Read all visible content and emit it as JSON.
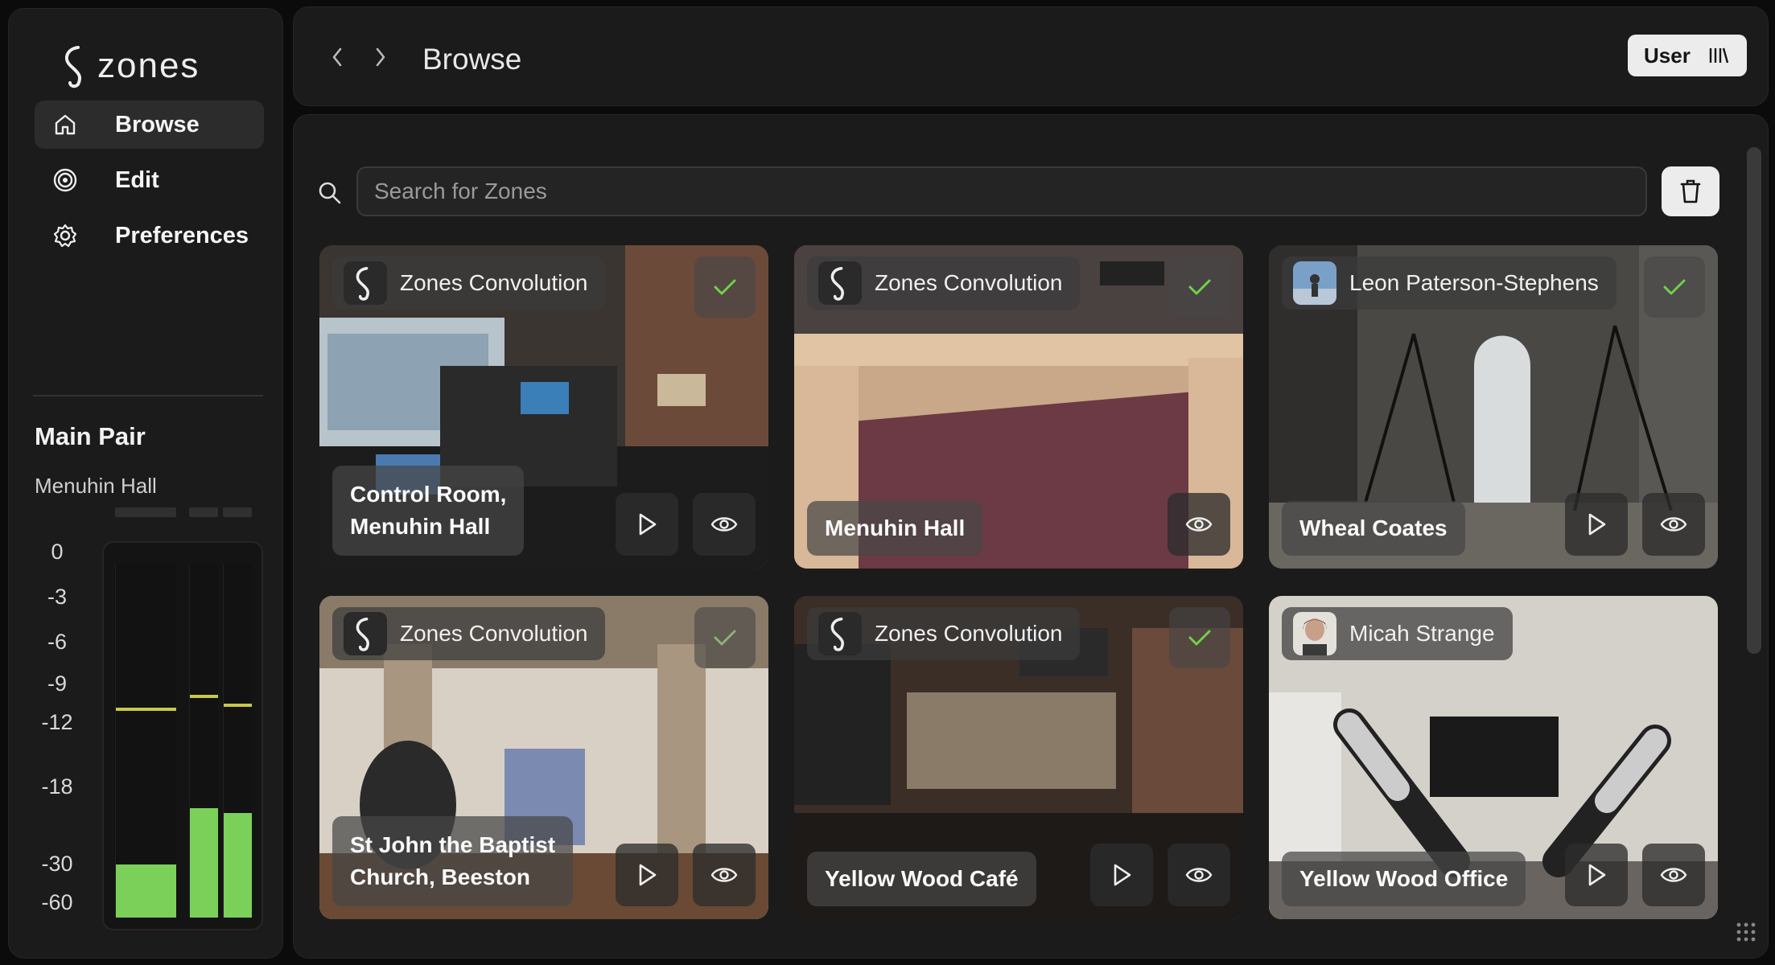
{
  "app": {
    "name": "zones"
  },
  "nav": {
    "items": [
      {
        "label": "Browse",
        "icon": "home-icon",
        "active": true
      },
      {
        "label": "Edit",
        "icon": "target-icon",
        "active": false
      },
      {
        "label": "Preferences",
        "icon": "gear-icon",
        "active": false
      }
    ]
  },
  "monitor": {
    "title": "Main Pair",
    "zone": "Menuhin Hall",
    "scale": [
      "0",
      "-3",
      "-6",
      "-9",
      "-12",
      "-18",
      "-30",
      "-60"
    ],
    "channels": [
      {
        "level": 0.15,
        "peak": 0.585
      },
      {
        "level": 0.31,
        "peak": 0.62
      },
      {
        "level": 0.295,
        "peak": 0.595
      }
    ]
  },
  "topbar": {
    "title": "Browse",
    "user_label": "User"
  },
  "search": {
    "placeholder": "Search for Zones"
  },
  "cards": [
    {
      "author": "Zones Convolution",
      "author_type": "logo",
      "title_line1": "Control Room,",
      "title_line2": "Menuhin Hall",
      "checked": true,
      "check_color": "#6fd24a"
    },
    {
      "author": "Zones Convolution",
      "author_type": "logo",
      "title_line1": "Menuhin Hall",
      "title_line2": "",
      "checked": true,
      "check_color": "#6fd24a"
    },
    {
      "author": "Leon Paterson-Stephens",
      "author_type": "photo",
      "title_line1": "Wheal Coates",
      "title_line2": "",
      "checked": true,
      "check_color": "#6fd24a"
    },
    {
      "author": "Zones Convolution",
      "author_type": "logo",
      "title_line1": "St John the Baptist",
      "title_line2": "Church, Beeston",
      "checked": true,
      "check_color": "#8fb07a"
    },
    {
      "author": "Zones Convolution",
      "author_type": "logo",
      "title_line1": "Yellow Wood Café",
      "title_line2": "",
      "checked": true,
      "check_color": "#6fd24a"
    },
    {
      "author": "Micah Strange",
      "author_type": "photo",
      "title_line1": "Yellow Wood Office",
      "title_line2": "",
      "checked": false,
      "check_color": ""
    }
  ],
  "colors": {
    "accent": "#7bd05a",
    "peak": "#c8c84a",
    "panel": "#1b1b1b",
    "background": "#0b0b0b"
  }
}
